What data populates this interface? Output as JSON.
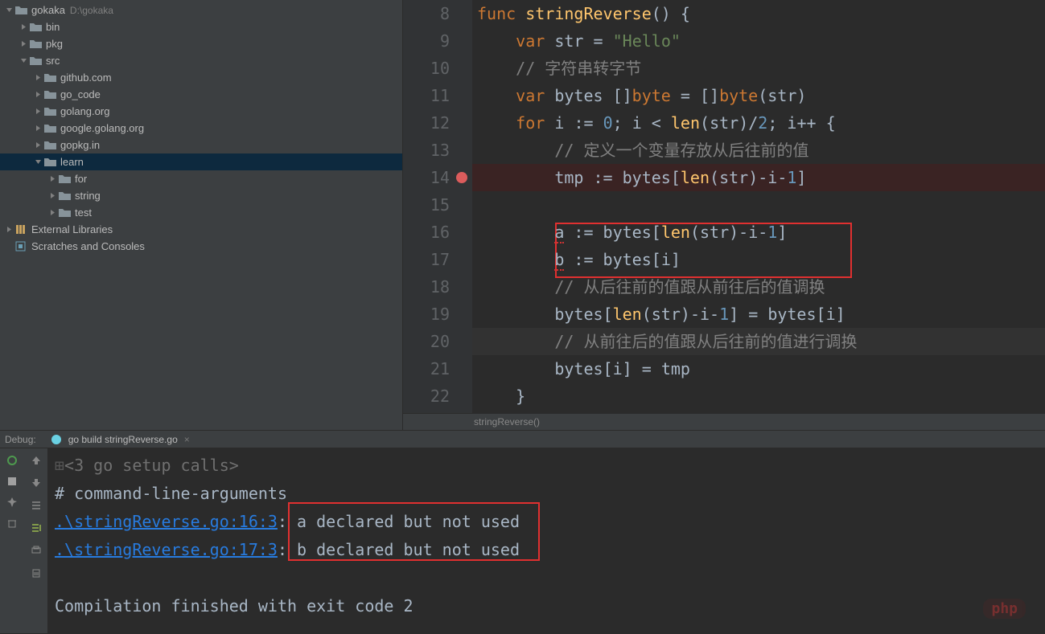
{
  "project": {
    "name": "gokaka",
    "path": "D:\\gokaka"
  },
  "tree": [
    {
      "indent": 0,
      "arrow": "down",
      "icon": "folder",
      "label": "gokaka",
      "path": "D:\\gokaka"
    },
    {
      "indent": 1,
      "arrow": "right",
      "icon": "folder",
      "label": "bin"
    },
    {
      "indent": 1,
      "arrow": "right",
      "icon": "folder",
      "label": "pkg"
    },
    {
      "indent": 1,
      "arrow": "down",
      "icon": "folder",
      "label": "src"
    },
    {
      "indent": 2,
      "arrow": "right",
      "icon": "folder",
      "label": "github.com"
    },
    {
      "indent": 2,
      "arrow": "right",
      "icon": "folder",
      "label": "go_code"
    },
    {
      "indent": 2,
      "arrow": "right",
      "icon": "folder",
      "label": "golang.org"
    },
    {
      "indent": 2,
      "arrow": "right",
      "icon": "folder",
      "label": "google.golang.org"
    },
    {
      "indent": 2,
      "arrow": "right",
      "icon": "folder",
      "label": "gopkg.in"
    },
    {
      "indent": 2,
      "arrow": "down",
      "icon": "folder",
      "label": "learn",
      "selected": true
    },
    {
      "indent": 3,
      "arrow": "right",
      "icon": "folder",
      "label": "for"
    },
    {
      "indent": 3,
      "arrow": "right",
      "icon": "folder",
      "label": "string"
    },
    {
      "indent": 3,
      "arrow": "right",
      "icon": "folder",
      "label": "test"
    },
    {
      "indent": 0,
      "arrow": "right",
      "icon": "lib",
      "label": "External Libraries"
    },
    {
      "indent": 0,
      "arrow": "",
      "icon": "scratch",
      "label": "Scratches and Consoles"
    }
  ],
  "code_lines": [
    {
      "num": "8",
      "tokens": [
        [
          "k-func",
          "func "
        ],
        [
          "fn-name",
          "stringReverse"
        ],
        [
          "paren",
          "() {"
        ]
      ]
    },
    {
      "num": "9",
      "tokens": [
        [
          "",
          "    "
        ],
        [
          "k-var",
          "var "
        ],
        [
          "ident",
          "str "
        ],
        [
          "op",
          "= "
        ],
        [
          "string",
          "\"Hello\""
        ]
      ]
    },
    {
      "num": "10",
      "tokens": [
        [
          "",
          "    "
        ],
        [
          "comment",
          "// 字符串转字节"
        ]
      ]
    },
    {
      "num": "11",
      "tokens": [
        [
          "",
          "    "
        ],
        [
          "k-var",
          "var "
        ],
        [
          "ident",
          "bytes []"
        ],
        [
          "type",
          "byte"
        ],
        [
          "ident",
          " = []"
        ],
        [
          "type",
          "byte"
        ],
        [
          "paren",
          "("
        ],
        [
          "ident",
          "str"
        ],
        [
          "paren",
          ")"
        ]
      ]
    },
    {
      "num": "12",
      "tokens": [
        [
          "",
          "    "
        ],
        [
          "k-for",
          "for "
        ],
        [
          "ident",
          "i "
        ],
        [
          "op",
          ":= "
        ],
        [
          "num",
          "0"
        ],
        [
          "op",
          "; "
        ],
        [
          "ident",
          "i "
        ],
        [
          "op",
          "< "
        ],
        [
          "len",
          "len"
        ],
        [
          "paren",
          "("
        ],
        [
          "ident",
          "str"
        ],
        [
          "paren",
          ")"
        ],
        [
          "op",
          "/"
        ],
        [
          "num",
          "2"
        ],
        [
          "op",
          "; "
        ],
        [
          "ident",
          "i"
        ],
        [
          "op",
          "++ {"
        ]
      ]
    },
    {
      "num": "13",
      "tokens": [
        [
          "",
          "        "
        ],
        [
          "comment",
          "// 定义一个变量存放从后往前的值"
        ]
      ]
    },
    {
      "num": "14",
      "bp": true,
      "tokens": [
        [
          "",
          "        "
        ],
        [
          "ident",
          "tmp "
        ],
        [
          "op",
          ":= "
        ],
        [
          "ident",
          "bytes"
        ],
        [
          "brack",
          "["
        ],
        [
          "len",
          "len"
        ],
        [
          "paren",
          "("
        ],
        [
          "ident",
          "str"
        ],
        [
          "paren",
          ")"
        ],
        [
          "op",
          "-"
        ],
        [
          "ident",
          "i"
        ],
        [
          "op",
          "-"
        ],
        [
          "num",
          "1"
        ],
        [
          "brack",
          "]"
        ]
      ]
    },
    {
      "num": "15",
      "tokens": [
        [
          "",
          ""
        ]
      ]
    },
    {
      "num": "16",
      "tokens": [
        [
          "",
          "        "
        ],
        [
          "squiggle",
          "a"
        ],
        [
          "ident",
          " "
        ],
        [
          "op",
          ":= "
        ],
        [
          "ident",
          "bytes"
        ],
        [
          "brack",
          "["
        ],
        [
          "len",
          "len"
        ],
        [
          "paren",
          "("
        ],
        [
          "ident",
          "str"
        ],
        [
          "paren",
          ")"
        ],
        [
          "op",
          "-"
        ],
        [
          "ident",
          "i"
        ],
        [
          "op",
          "-"
        ],
        [
          "num",
          "1"
        ],
        [
          "brack",
          "]"
        ]
      ]
    },
    {
      "num": "17",
      "tokens": [
        [
          "",
          "        "
        ],
        [
          "squiggle",
          "b"
        ],
        [
          "ident",
          " "
        ],
        [
          "op",
          ":= "
        ],
        [
          "ident",
          "bytes"
        ],
        [
          "brack",
          "["
        ],
        [
          "ident",
          "i"
        ],
        [
          "brack",
          "]"
        ]
      ]
    },
    {
      "num": "18",
      "tokens": [
        [
          "",
          "        "
        ],
        [
          "comment",
          "// 从后往前的值跟从前往后的值调换"
        ]
      ]
    },
    {
      "num": "19",
      "tokens": [
        [
          "",
          "        "
        ],
        [
          "ident",
          "bytes"
        ],
        [
          "brack",
          "["
        ],
        [
          "len",
          "len"
        ],
        [
          "paren",
          "("
        ],
        [
          "ident",
          "str"
        ],
        [
          "paren",
          ")"
        ],
        [
          "op",
          "-"
        ],
        [
          "ident",
          "i"
        ],
        [
          "op",
          "-"
        ],
        [
          "num",
          "1"
        ],
        [
          "brack",
          "] "
        ],
        [
          "op",
          "= "
        ],
        [
          "ident",
          "bytes"
        ],
        [
          "brack",
          "["
        ],
        [
          "ident",
          "i"
        ],
        [
          "brack",
          "]"
        ]
      ]
    },
    {
      "num": "20",
      "cur": true,
      "tokens": [
        [
          "",
          "        "
        ],
        [
          "comment",
          "// 从前往后的值跟从后往前的值进行调换"
        ]
      ]
    },
    {
      "num": "21",
      "tokens": [
        [
          "",
          "        "
        ],
        [
          "ident",
          "bytes"
        ],
        [
          "brack",
          "["
        ],
        [
          "ident",
          "i"
        ],
        [
          "brack",
          "] "
        ],
        [
          "op",
          "= "
        ],
        [
          "ident",
          "tmp"
        ]
      ]
    },
    {
      "num": "22",
      "tokens": [
        [
          "",
          "    }"
        ]
      ]
    }
  ],
  "breadcrumb": "stringReverse()",
  "debug_label": "Debug:",
  "debug_tab": "go build stringReverse.go",
  "console": {
    "line0": "<3 go setup calls>",
    "line1": "# command-line-arguments",
    "link1": ".\\stringReverse.go:16:3",
    "err1": "a declared but not used",
    "link2": ".\\stringReverse.go:17:3",
    "err2": "b declared but not used",
    "final": "Compilation finished with exit code 2"
  },
  "watermark": "php"
}
